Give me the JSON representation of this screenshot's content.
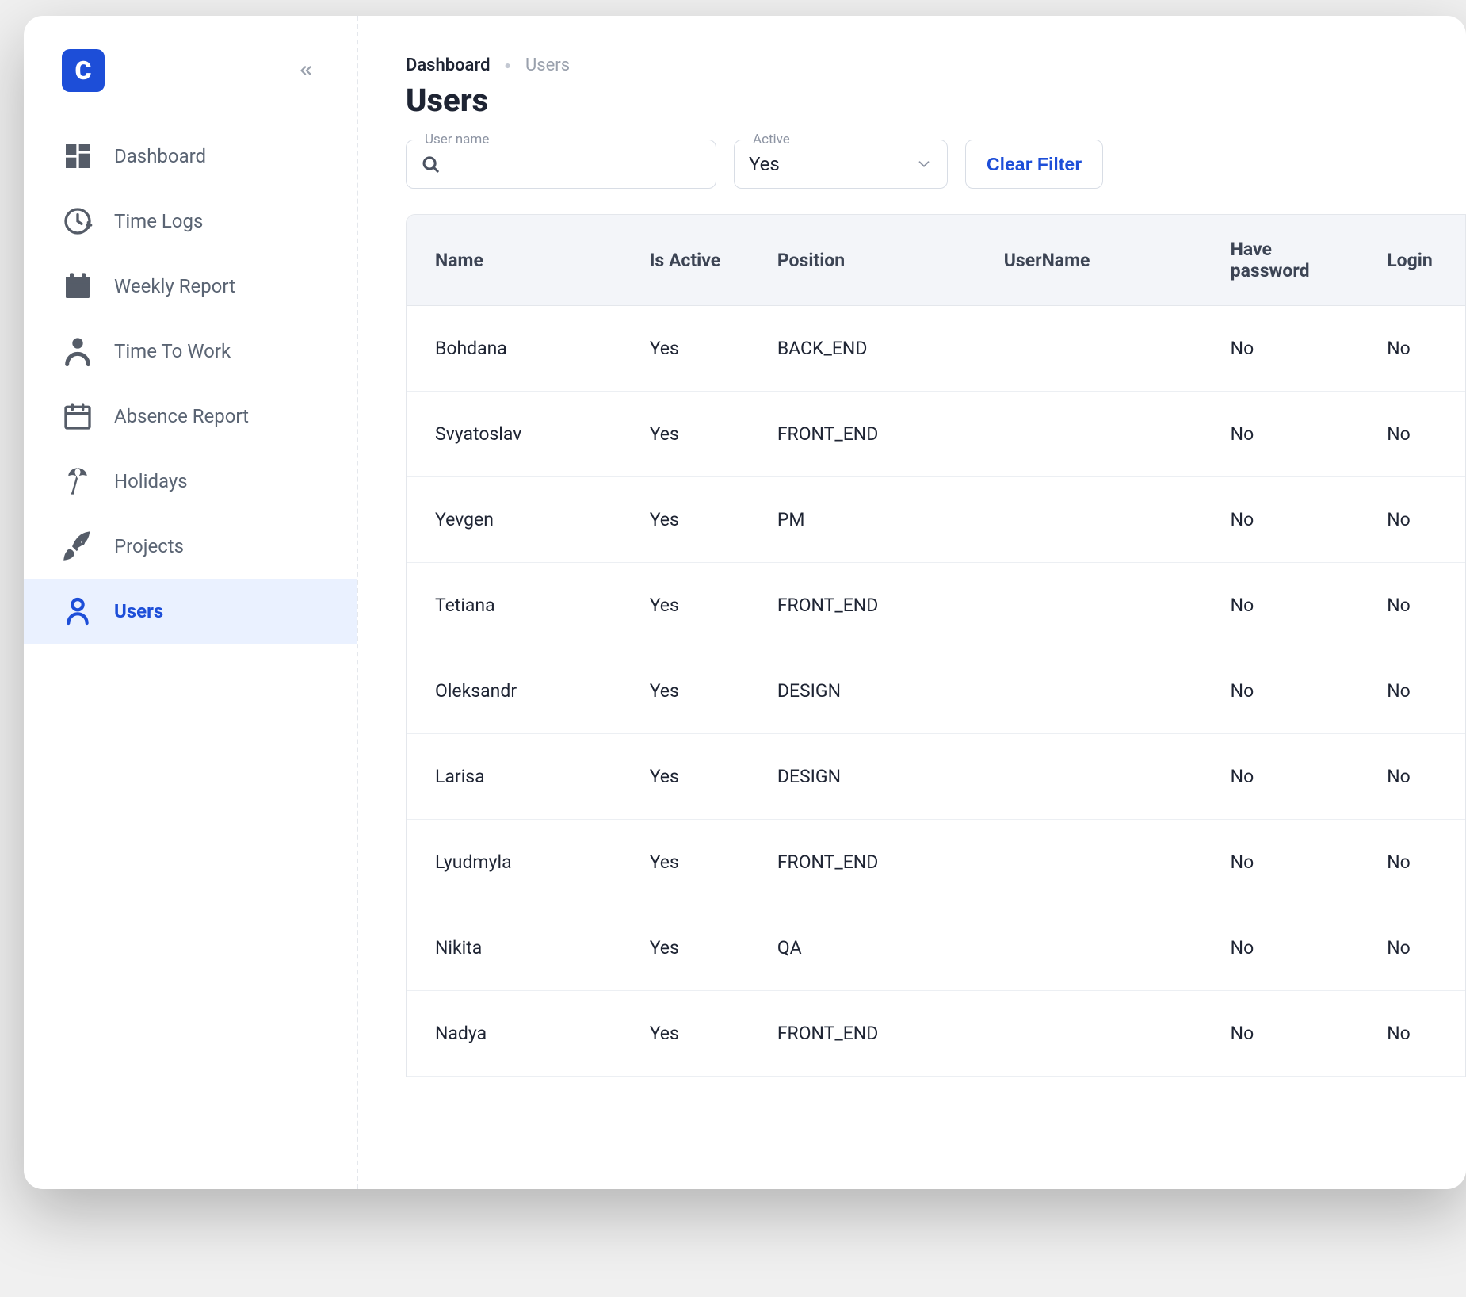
{
  "sidebar": {
    "items": [
      {
        "key": "dashboard",
        "label": "Dashboard",
        "active": false
      },
      {
        "key": "timelogs",
        "label": "Time Logs",
        "active": false
      },
      {
        "key": "weeklyreport",
        "label": "Weekly Report",
        "active": false
      },
      {
        "key": "timetowork",
        "label": "Time To Work",
        "active": false
      },
      {
        "key": "absencereport",
        "label": "Absence Report",
        "active": false
      },
      {
        "key": "holidays",
        "label": "Holidays",
        "active": false
      },
      {
        "key": "projects",
        "label": "Projects",
        "active": false
      },
      {
        "key": "users",
        "label": "Users",
        "active": true
      }
    ]
  },
  "breadcrumb": {
    "root": "Dashboard",
    "current": "Users"
  },
  "page": {
    "title": "Users"
  },
  "filters": {
    "username": {
      "label": "User name",
      "value": ""
    },
    "active": {
      "label": "Active",
      "value": "Yes"
    },
    "clear_label": "Clear Filter"
  },
  "table": {
    "columns": [
      "Name",
      "Is Active",
      "Position",
      "UserName",
      "Have password",
      "Login"
    ],
    "rows": [
      [
        "Bohdana",
        "Yes",
        "BACK_END",
        "",
        "No",
        "No"
      ],
      [
        "Svyatoslav",
        "Yes",
        "FRONT_END",
        "",
        "No",
        "No"
      ],
      [
        "Yevgen",
        "Yes",
        "PM",
        "",
        "No",
        "No"
      ],
      [
        "Tetiana",
        "Yes",
        "FRONT_END",
        "",
        "No",
        "No"
      ],
      [
        "Oleksandr",
        "Yes",
        "DESIGN",
        "",
        "No",
        "No"
      ],
      [
        "Larisa",
        "Yes",
        "DESIGN",
        "",
        "No",
        "No"
      ],
      [
        "Lyudmyla",
        "Yes",
        "FRONT_END",
        "",
        "No",
        "No"
      ],
      [
        "Nikita",
        "Yes",
        "QA",
        "",
        "No",
        "No"
      ],
      [
        "Nadya",
        "Yes",
        "FRONT_END",
        "",
        "No",
        "No"
      ]
    ]
  }
}
